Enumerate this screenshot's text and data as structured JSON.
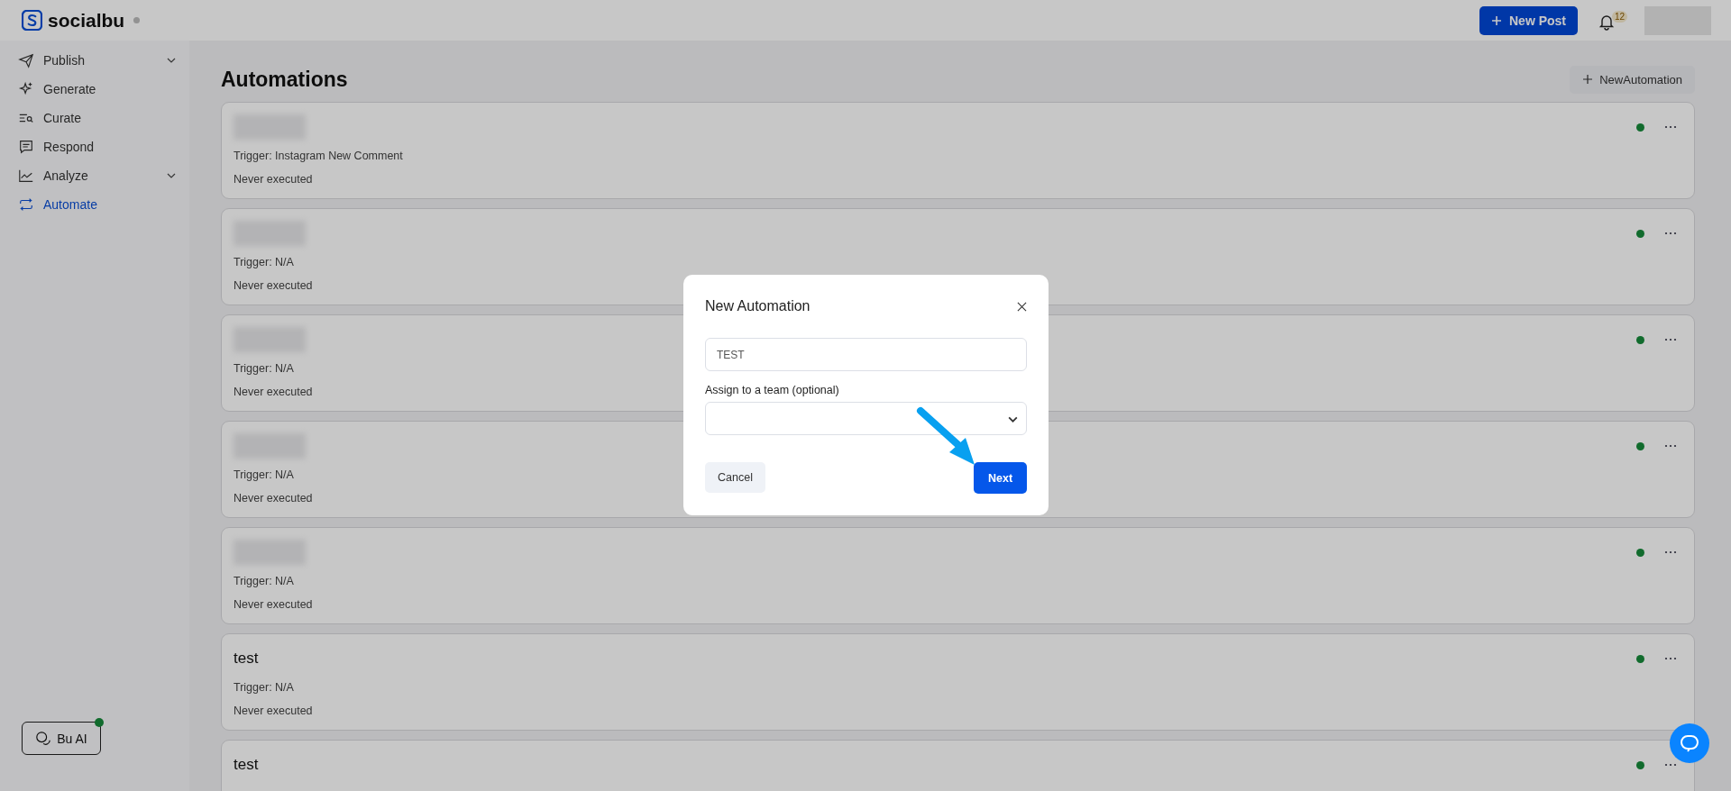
{
  "brand": {
    "name": "socialbu"
  },
  "header": {
    "new_post": "New Post",
    "notifications_count": "12"
  },
  "sidebar": {
    "items": [
      {
        "label": "Publish",
        "expandable": true,
        "selected": false
      },
      {
        "label": "Generate",
        "expandable": false,
        "selected": false
      },
      {
        "label": "Curate",
        "expandable": false,
        "selected": false
      },
      {
        "label": "Respond",
        "expandable": false,
        "selected": false
      },
      {
        "label": "Analyze",
        "expandable": true,
        "selected": false
      },
      {
        "label": "Automate",
        "expandable": false,
        "selected": true
      }
    ],
    "bu_ai": {
      "label": "Bu AI",
      "online": true
    }
  },
  "page": {
    "title": "Automations",
    "new_button": "NewAutomation"
  },
  "automations": [
    {
      "kind": "redacted",
      "trigger": "Trigger: Instagram New Comment",
      "status": "Never executed",
      "active": true
    },
    {
      "kind": "redacted",
      "trigger": "Trigger: N/A",
      "status": "Never executed",
      "active": true
    },
    {
      "kind": "redacted",
      "trigger": "Trigger: N/A",
      "status": "Never executed",
      "active": true
    },
    {
      "kind": "redacted",
      "trigger": "Trigger: N/A",
      "status": "Never executed",
      "active": true
    },
    {
      "kind": "redacted",
      "trigger": "Trigger: N/A",
      "status": "Never executed",
      "active": true
    },
    {
      "kind": "named",
      "name": "test",
      "trigger": "Trigger: N/A",
      "status": "Never executed",
      "active": true
    },
    {
      "kind": "named",
      "name": "test",
      "active": true
    }
  ],
  "modal": {
    "title": "New Automation",
    "name_value": "TEST",
    "team_label": "Assign to a team (optional)",
    "cancel": "Cancel",
    "next": "Next"
  }
}
